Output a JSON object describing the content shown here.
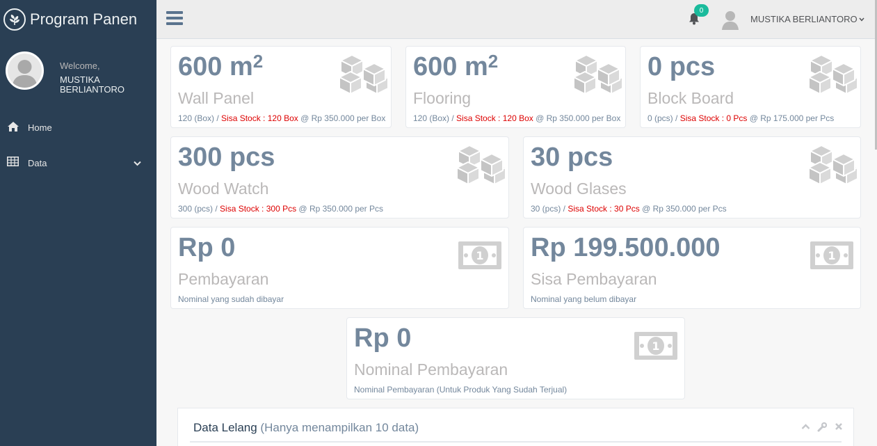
{
  "brand": {
    "title": "Program Panen",
    "logo_icon": "leaf-icon"
  },
  "profile": {
    "welcome": "Welcome,",
    "name": "MUSTIKA BERLIANTORO"
  },
  "nav": [
    {
      "label": "Home",
      "icon": "home-icon"
    },
    {
      "label": "Data",
      "icon": "table-icon"
    }
  ],
  "topbar": {
    "notif_count": "0",
    "user_name": "MUSTIKA BERLIANTORO"
  },
  "tiles": [
    {
      "value": "600 m",
      "sup": "2",
      "label": "Wall Panel",
      "foot_a": "120 (Box) / ",
      "foot_red": "Sisa Stock : 120 Box",
      "foot_b": " @ Rp 350.000 per Box",
      "icon": "cubes-icon"
    },
    {
      "value": "600 m",
      "sup": "2",
      "label": "Flooring",
      "foot_a": "120 (Box) / ",
      "foot_red": "Sisa Stock : 120 Box",
      "foot_b": " @ Rp 350.000 per Box",
      "icon": "cubes-icon"
    },
    {
      "value": "0 pcs",
      "label": "Block Board",
      "foot_a": "0 (pcs) / ",
      "foot_red": "Sisa Stock : 0 Pcs",
      "foot_b": " @ Rp 175.000 per Pcs",
      "icon": "cubes-icon"
    },
    {
      "value": "300 pcs",
      "label": "Wood Watch",
      "foot_a": "300 (pcs) / ",
      "foot_red": "Sisa Stock : 300 Pcs",
      "foot_b": " @ Rp 350.000 per Pcs",
      "icon": "cubes-icon"
    },
    {
      "value": "30 pcs",
      "label": "Wood Glases",
      "foot_a": "30 (pcs) / ",
      "foot_red": "Sisa Stock : 30 Pcs",
      "foot_b": " @ Rp 350.000 per Pcs",
      "icon": "cubes-icon"
    },
    {
      "value": "Rp 0",
      "label": "Pembayaran",
      "foot_a": "Nominal yang sudah dibayar",
      "icon": "money-icon"
    },
    {
      "value": "Rp 199.500.000",
      "label": "Sisa Pembayaran",
      "foot_a": "Nominal yang belum dibayar",
      "icon": "money-icon"
    },
    {
      "value": "Rp 0",
      "label": "Nominal Pembayaran",
      "foot_a": "Nominal Pembayaran (Untuk Produk Yang Sudah Terjual)",
      "icon": "money-icon"
    }
  ],
  "panel": {
    "title": "Data Lelang",
    "subtitle": "(Hanya menampilkan 10 data)"
  },
  "colors": {
    "sidebar": "#2a3f54",
    "accent": "#1abb9c",
    "tile_text": "#73879c",
    "stock_red": "#dd0000"
  }
}
